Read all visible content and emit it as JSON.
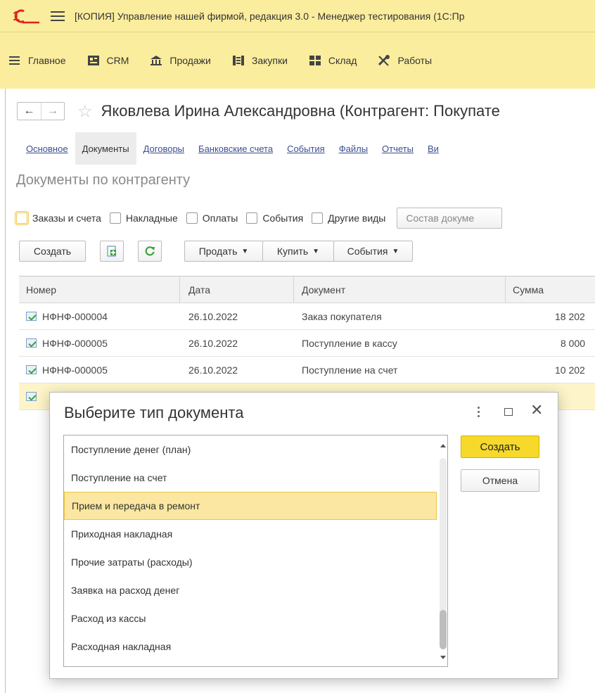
{
  "app": {
    "title": "[КОПИЯ] Управление нашей фирмой, редакция 3.0  - Менеджер тестирования (1С:Пр",
    "colors": {
      "header_bg": "#fbed9e",
      "accent": "#f6d92a",
      "logo_red": "#e2211c"
    }
  },
  "sections": [
    {
      "label": "Главное",
      "icon": "hamburger-icon"
    },
    {
      "label": "CRM",
      "icon": "crm-icon"
    },
    {
      "label": "Продажи",
      "icon": "sales-icon"
    },
    {
      "label": "Закупки",
      "icon": "purchases-icon"
    },
    {
      "label": "Склад",
      "icon": "warehouse-icon"
    },
    {
      "label": "Работы",
      "icon": "tools-icon"
    }
  ],
  "page": {
    "title": "Яковлева Ирина Александровна (Контрагент: Покупате",
    "tabs": [
      "Основное",
      "Документы",
      "Договоры",
      "Банковские счета",
      "События",
      "Файлы",
      "Отчеты",
      "Ви"
    ],
    "active_tab": "Документы",
    "section_title": "Документы по контрагенту"
  },
  "filters": {
    "checkboxes": [
      "Заказы и счета",
      "Накладные",
      "Оплаты",
      "События",
      "Другие виды"
    ],
    "composition_button": "Состав докуме"
  },
  "toolbar": {
    "create": "Создать",
    "sell": "Продать",
    "buy": "Купить",
    "events": "События"
  },
  "grid": {
    "columns": [
      "Номер",
      "Дата",
      "Документ",
      "Сумма"
    ],
    "rows": [
      {
        "number": "НФНФ-000004",
        "date": "26.10.2022",
        "document": "Заказ покупателя",
        "sum": "18 202"
      },
      {
        "number": "НФНФ-000005",
        "date": "26.10.2022",
        "document": "Поступление в кассу",
        "sum": "8 000"
      },
      {
        "number": "НФНФ-000005",
        "date": "26.10.2022",
        "document": "Поступление на счет",
        "sum": "10 202"
      }
    ]
  },
  "dialog": {
    "title": "Выберите тип документа",
    "items": [
      "Поступление денег (план)",
      "Поступление на счет",
      "Прием и передача в ремонт",
      "Приходная накладная",
      "Прочие затраты (расходы)",
      "Заявка на расход денег",
      "Расход из кассы",
      "Расходная накладная"
    ],
    "selected_index": 2,
    "create_button": "Создать",
    "cancel_button": "Отмена"
  }
}
